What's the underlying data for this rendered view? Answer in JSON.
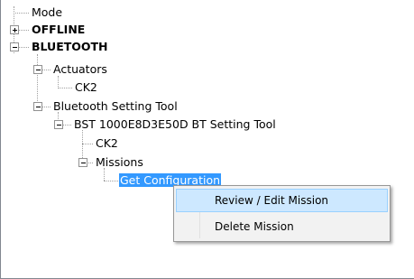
{
  "tree": {
    "nodes": [
      {
        "label": "Mode"
      },
      {
        "label": "OFFLINE"
      },
      {
        "label": "BLUETOOTH"
      },
      {
        "label": "Actuators"
      },
      {
        "label": "CK2"
      },
      {
        "label": "Bluetooth Setting Tool"
      },
      {
        "label": "BST 1000E8D3E50D BT Setting Tool"
      },
      {
        "label": "CK2"
      },
      {
        "label": "Missions"
      },
      {
        "label": "Get Configuration"
      }
    ]
  },
  "context_menu": {
    "items": [
      {
        "label": "Review / Edit Mission"
      },
      {
        "label": "Delete Mission"
      }
    ]
  },
  "colors": {
    "selection": "#3399ff",
    "menu_hover": "#cde8ff",
    "menu_background": "#f2f2f2"
  }
}
